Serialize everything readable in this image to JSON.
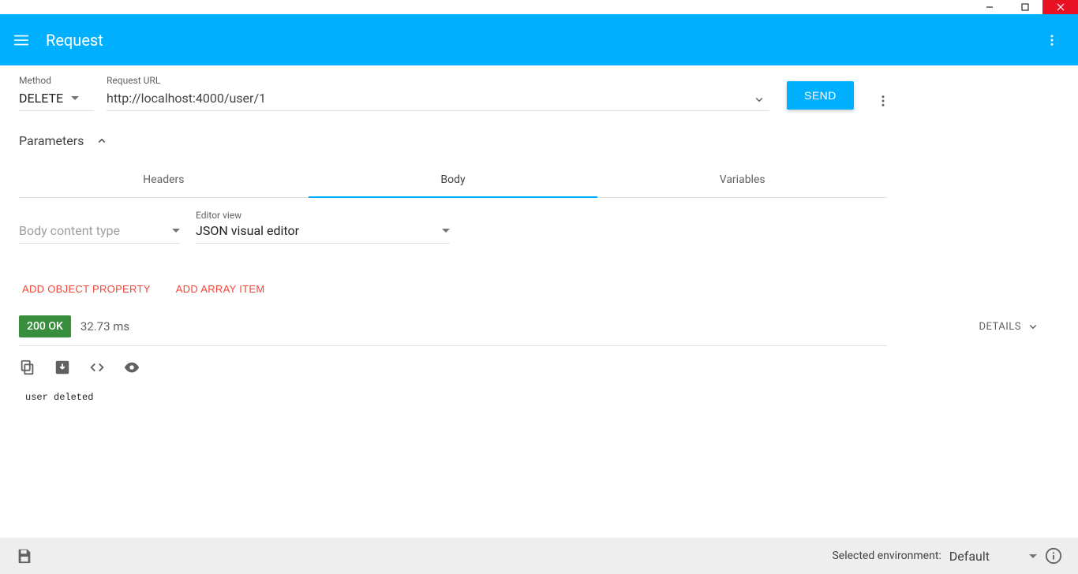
{
  "header": {
    "title": "Request"
  },
  "request": {
    "method_label": "Method",
    "method": "DELETE",
    "url_label": "Request URL",
    "url": "http://localhost:4000/user/1",
    "send_label": "SEND"
  },
  "parameters_label": "Parameters",
  "tabs": {
    "headers": "Headers",
    "body": "Body",
    "variables": "Variables",
    "active": "body"
  },
  "body_editor": {
    "content_type_placeholder": "Body content type",
    "editor_view_label": "Editor view",
    "editor_view_value": "JSON visual editor"
  },
  "json_actions": {
    "add_object": "ADD OBJECT PROPERTY",
    "add_array": "ADD ARRAY ITEM"
  },
  "response": {
    "status": "200 OK",
    "time": "32.73 ms",
    "details_label": "DETAILS",
    "body": "user deleted"
  },
  "footer": {
    "env_label": "Selected environment:",
    "env_value": "Default"
  }
}
